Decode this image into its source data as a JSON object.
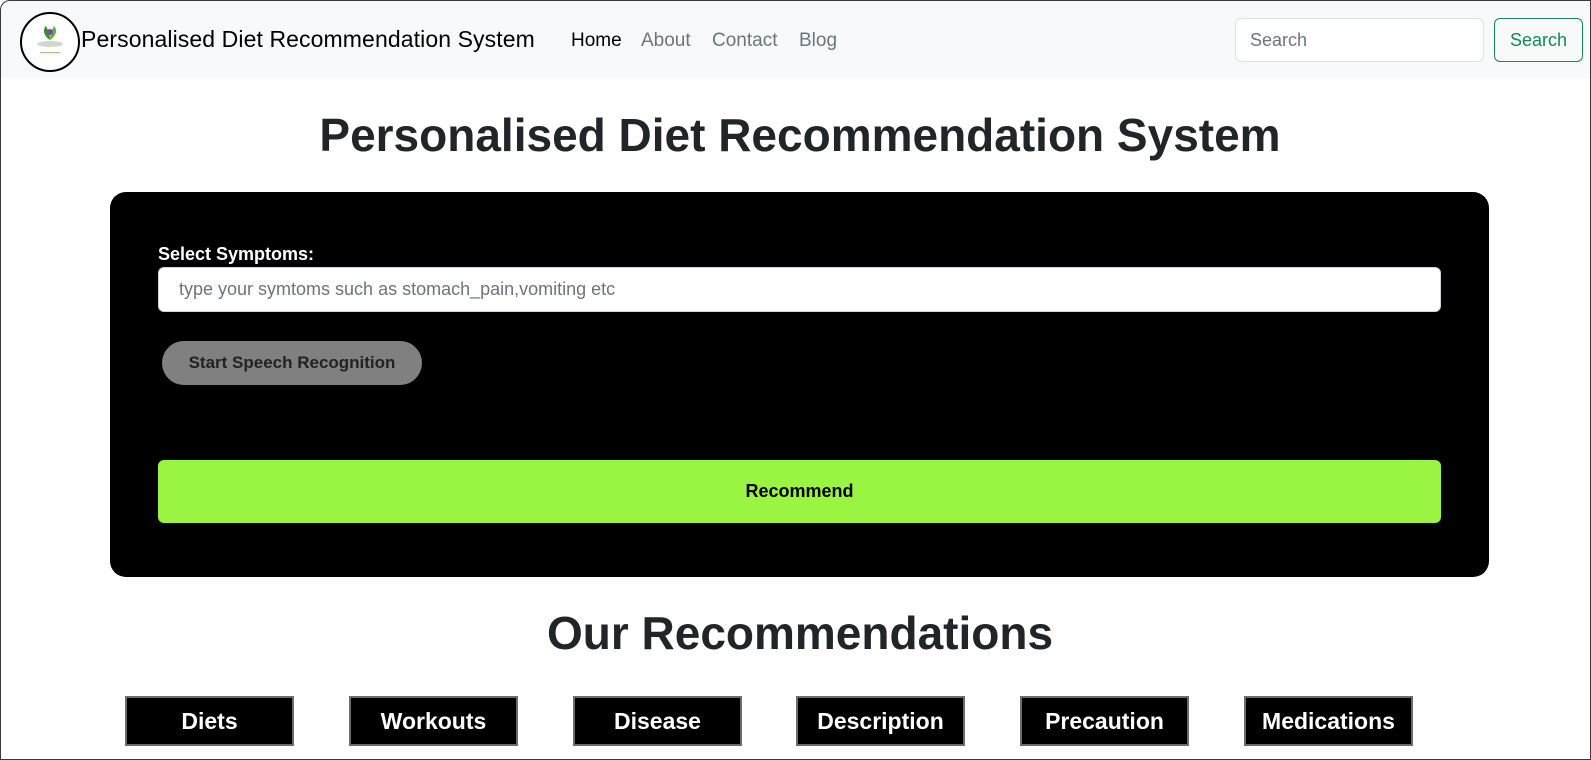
{
  "navbar": {
    "brand": "Personalised Diet Recommendation System",
    "links": [
      {
        "label": "Home",
        "active": true
      },
      {
        "label": "About",
        "active": false
      },
      {
        "label": "Contact",
        "active": false
      },
      {
        "label": "Blog",
        "active": false
      }
    ],
    "search_placeholder": "Search",
    "search_button": "Search"
  },
  "main": {
    "title": "Personalised Diet Recommendation System",
    "form": {
      "symptoms_label": "Select Symptoms:",
      "symptoms_placeholder": "type your symtoms such as stomach_pain,vomiting etc",
      "speech_button": "Start Speech Recognition",
      "recommend_button": "Recommend"
    },
    "recommendations_title": "Our Recommendations",
    "tabs": [
      "Diets",
      "Workouts",
      "Disease",
      "Description",
      "Precaution",
      "Medications"
    ]
  },
  "colors": {
    "recommend_bg": "#99f542",
    "panel_bg": "#000000",
    "search_outline": "#198754",
    "navbar_bg": "#f8f9fa"
  },
  "icons": {
    "logo": "leaf-plate-logo-icon"
  }
}
